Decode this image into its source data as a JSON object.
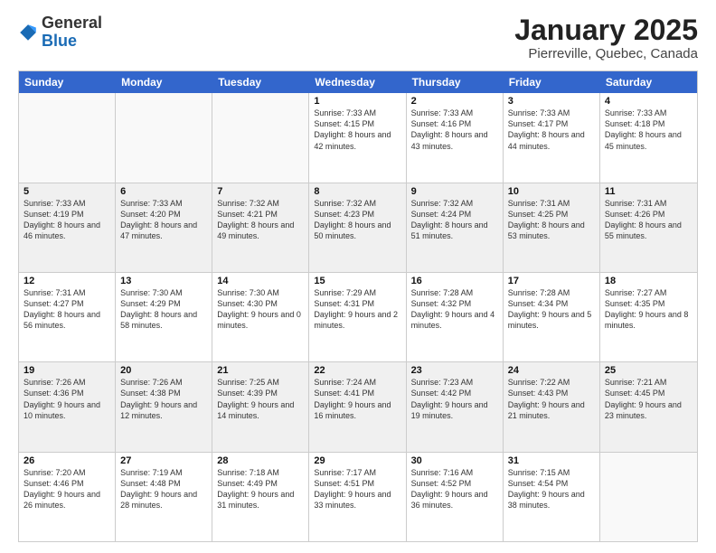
{
  "logo": {
    "general": "General",
    "blue": "Blue"
  },
  "title": "January 2025",
  "subtitle": "Pierreville, Quebec, Canada",
  "days_of_week": [
    "Sunday",
    "Monday",
    "Tuesday",
    "Wednesday",
    "Thursday",
    "Friday",
    "Saturday"
  ],
  "weeks": [
    [
      {
        "day": "",
        "info": "",
        "empty": true
      },
      {
        "day": "",
        "info": "",
        "empty": true
      },
      {
        "day": "",
        "info": "",
        "empty": true
      },
      {
        "day": "1",
        "info": "Sunrise: 7:33 AM\nSunset: 4:15 PM\nDaylight: 8 hours and 42 minutes."
      },
      {
        "day": "2",
        "info": "Sunrise: 7:33 AM\nSunset: 4:16 PM\nDaylight: 8 hours and 43 minutes."
      },
      {
        "day": "3",
        "info": "Sunrise: 7:33 AM\nSunset: 4:17 PM\nDaylight: 8 hours and 44 minutes."
      },
      {
        "day": "4",
        "info": "Sunrise: 7:33 AM\nSunset: 4:18 PM\nDaylight: 8 hours and 45 minutes."
      }
    ],
    [
      {
        "day": "5",
        "info": "Sunrise: 7:33 AM\nSunset: 4:19 PM\nDaylight: 8 hours and 46 minutes."
      },
      {
        "day": "6",
        "info": "Sunrise: 7:33 AM\nSunset: 4:20 PM\nDaylight: 8 hours and 47 minutes."
      },
      {
        "day": "7",
        "info": "Sunrise: 7:32 AM\nSunset: 4:21 PM\nDaylight: 8 hours and 49 minutes."
      },
      {
        "day": "8",
        "info": "Sunrise: 7:32 AM\nSunset: 4:23 PM\nDaylight: 8 hours and 50 minutes."
      },
      {
        "day": "9",
        "info": "Sunrise: 7:32 AM\nSunset: 4:24 PM\nDaylight: 8 hours and 51 minutes."
      },
      {
        "day": "10",
        "info": "Sunrise: 7:31 AM\nSunset: 4:25 PM\nDaylight: 8 hours and 53 minutes."
      },
      {
        "day": "11",
        "info": "Sunrise: 7:31 AM\nSunset: 4:26 PM\nDaylight: 8 hours and 55 minutes."
      }
    ],
    [
      {
        "day": "12",
        "info": "Sunrise: 7:31 AM\nSunset: 4:27 PM\nDaylight: 8 hours and 56 minutes."
      },
      {
        "day": "13",
        "info": "Sunrise: 7:30 AM\nSunset: 4:29 PM\nDaylight: 8 hours and 58 minutes."
      },
      {
        "day": "14",
        "info": "Sunrise: 7:30 AM\nSunset: 4:30 PM\nDaylight: 9 hours and 0 minutes."
      },
      {
        "day": "15",
        "info": "Sunrise: 7:29 AM\nSunset: 4:31 PM\nDaylight: 9 hours and 2 minutes."
      },
      {
        "day": "16",
        "info": "Sunrise: 7:28 AM\nSunset: 4:32 PM\nDaylight: 9 hours and 4 minutes."
      },
      {
        "day": "17",
        "info": "Sunrise: 7:28 AM\nSunset: 4:34 PM\nDaylight: 9 hours and 5 minutes."
      },
      {
        "day": "18",
        "info": "Sunrise: 7:27 AM\nSunset: 4:35 PM\nDaylight: 9 hours and 8 minutes."
      }
    ],
    [
      {
        "day": "19",
        "info": "Sunrise: 7:26 AM\nSunset: 4:36 PM\nDaylight: 9 hours and 10 minutes."
      },
      {
        "day": "20",
        "info": "Sunrise: 7:26 AM\nSunset: 4:38 PM\nDaylight: 9 hours and 12 minutes."
      },
      {
        "day": "21",
        "info": "Sunrise: 7:25 AM\nSunset: 4:39 PM\nDaylight: 9 hours and 14 minutes."
      },
      {
        "day": "22",
        "info": "Sunrise: 7:24 AM\nSunset: 4:41 PM\nDaylight: 9 hours and 16 minutes."
      },
      {
        "day": "23",
        "info": "Sunrise: 7:23 AM\nSunset: 4:42 PM\nDaylight: 9 hours and 19 minutes."
      },
      {
        "day": "24",
        "info": "Sunrise: 7:22 AM\nSunset: 4:43 PM\nDaylight: 9 hours and 21 minutes."
      },
      {
        "day": "25",
        "info": "Sunrise: 7:21 AM\nSunset: 4:45 PM\nDaylight: 9 hours and 23 minutes."
      }
    ],
    [
      {
        "day": "26",
        "info": "Sunrise: 7:20 AM\nSunset: 4:46 PM\nDaylight: 9 hours and 26 minutes."
      },
      {
        "day": "27",
        "info": "Sunrise: 7:19 AM\nSunset: 4:48 PM\nDaylight: 9 hours and 28 minutes."
      },
      {
        "day": "28",
        "info": "Sunrise: 7:18 AM\nSunset: 4:49 PM\nDaylight: 9 hours and 31 minutes."
      },
      {
        "day": "29",
        "info": "Sunrise: 7:17 AM\nSunset: 4:51 PM\nDaylight: 9 hours and 33 minutes."
      },
      {
        "day": "30",
        "info": "Sunrise: 7:16 AM\nSunset: 4:52 PM\nDaylight: 9 hours and 36 minutes."
      },
      {
        "day": "31",
        "info": "Sunrise: 7:15 AM\nSunset: 4:54 PM\nDaylight: 9 hours and 38 minutes."
      },
      {
        "day": "",
        "info": "",
        "empty": true
      }
    ]
  ]
}
